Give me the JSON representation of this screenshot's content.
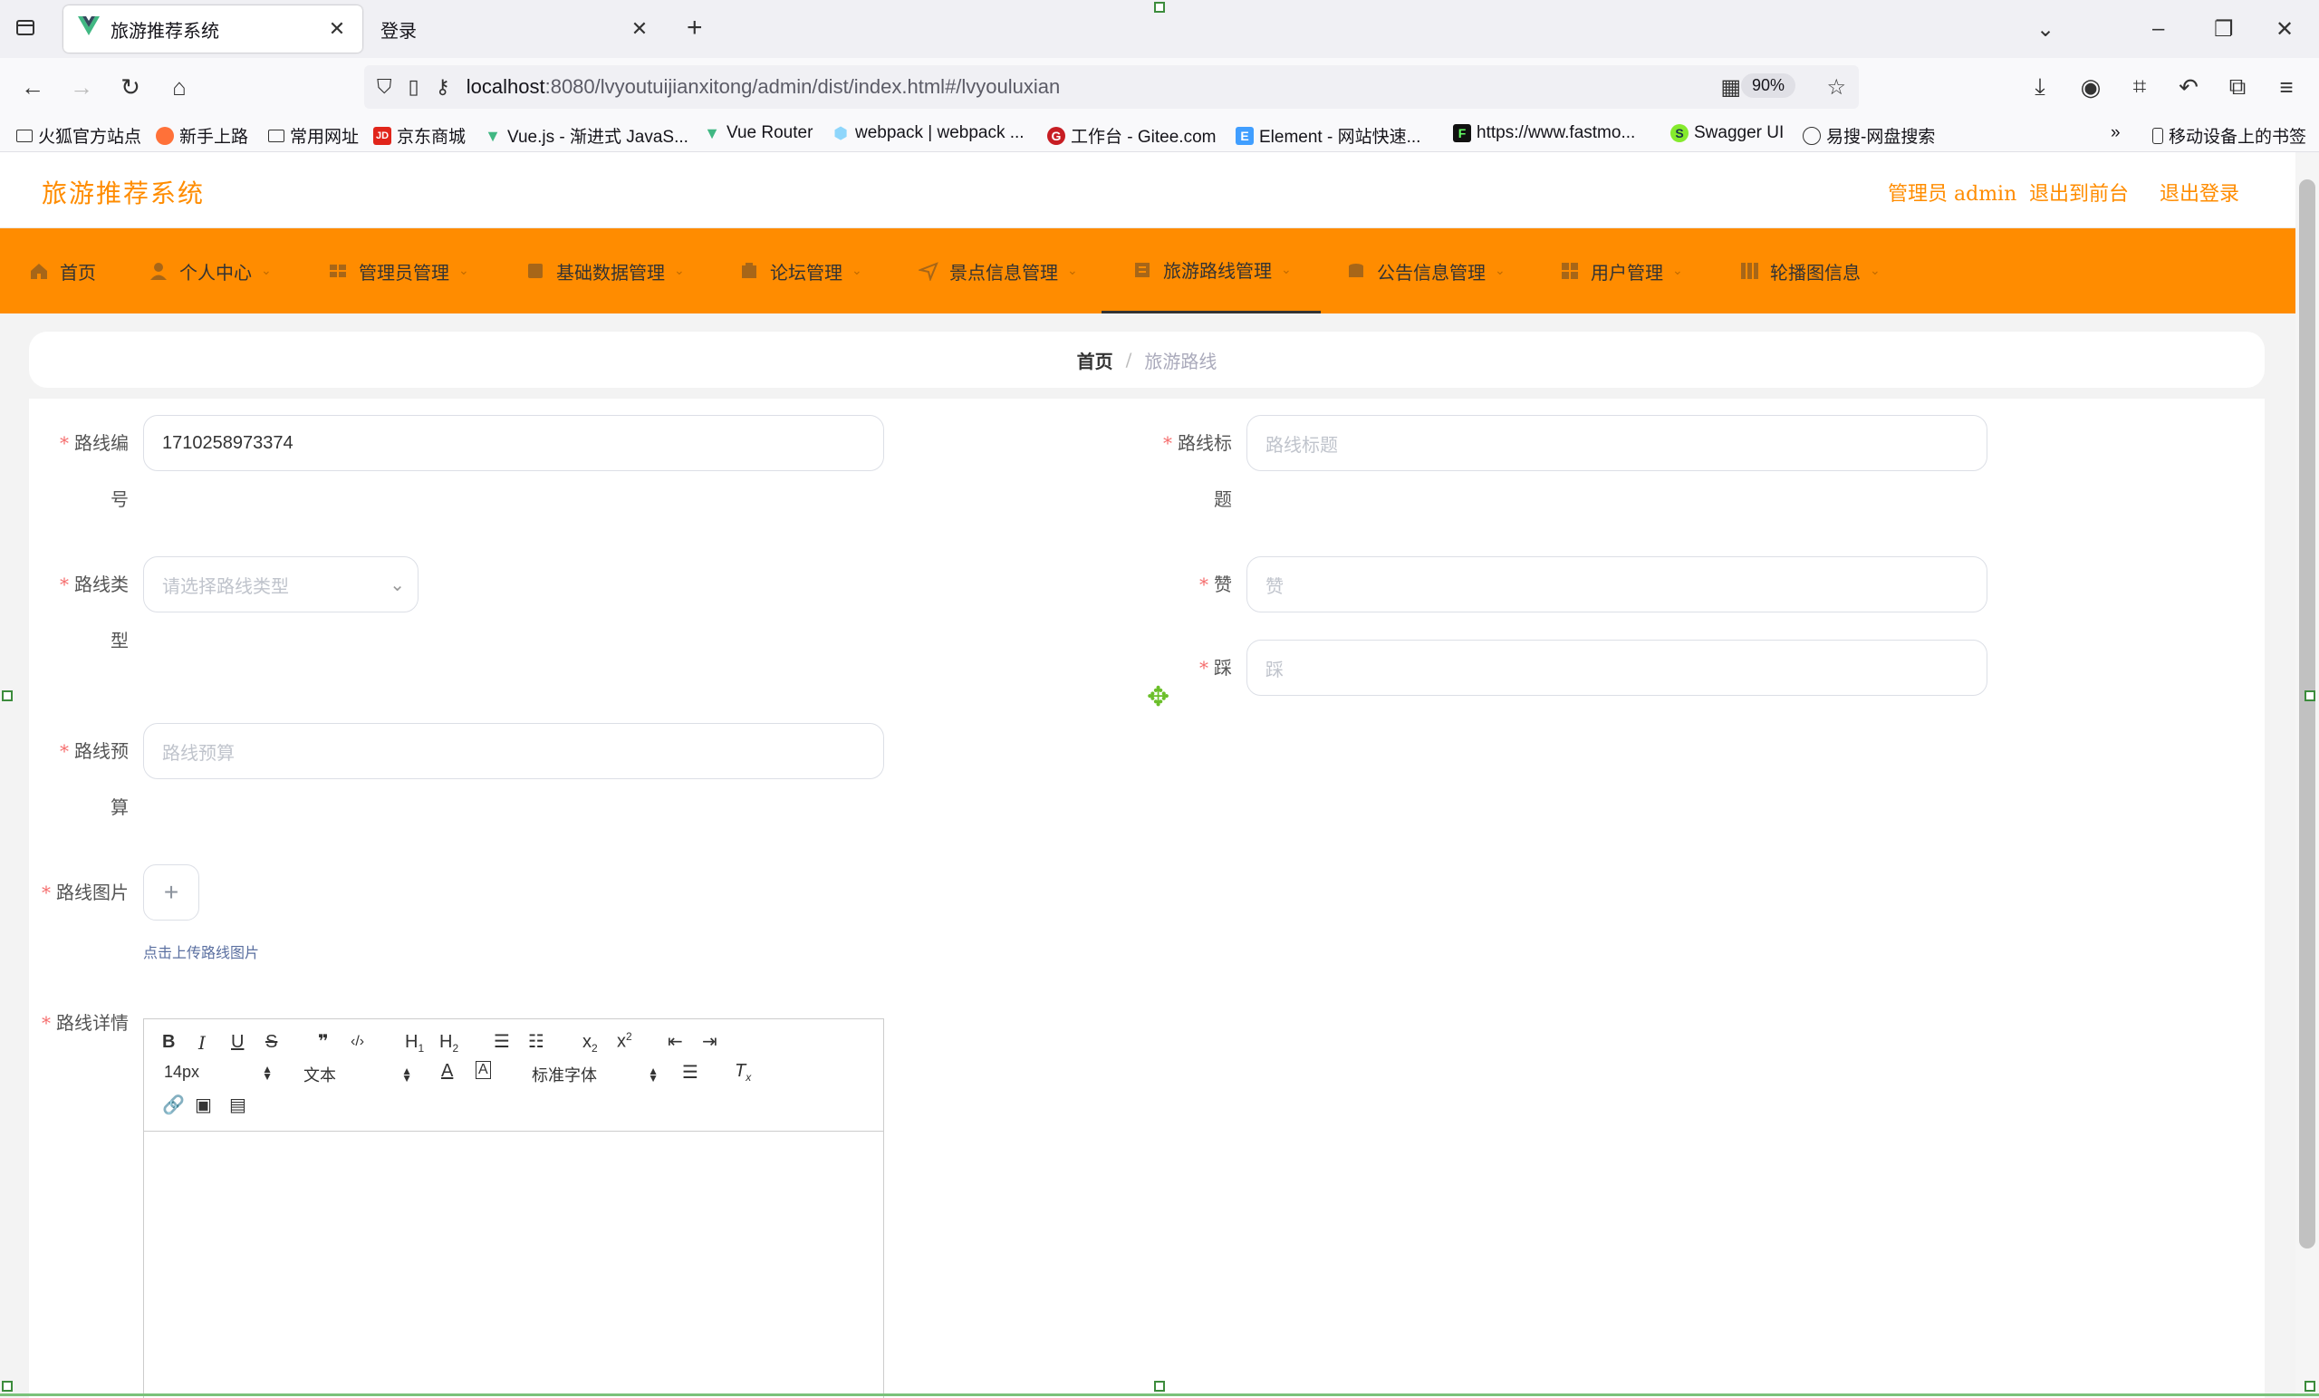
{
  "browser": {
    "tabs": [
      {
        "title": "旅游推荐系统",
        "active": true
      },
      {
        "title": "登录",
        "active": false
      }
    ],
    "url_host": "localhost",
    "url_rest": ":8080/lvyoutuijianxitong/admin/dist/index.html#/lvyouluxian",
    "zoom": "90%",
    "bookmarks": [
      {
        "label": "火狐官方站点",
        "icon": "folder-icon"
      },
      {
        "label": "新手上路",
        "icon": "firefox-icon"
      },
      {
        "label": "常用网址",
        "icon": "folder-icon"
      },
      {
        "label": "京东商城",
        "icon": "jd-icon"
      },
      {
        "label": "Vue.js - 渐进式 JavaS...",
        "icon": "vue-icon"
      },
      {
        "label": "Vue Router",
        "icon": "vue-icon"
      },
      {
        "label": "webpack | webpack ...",
        "icon": "webpack-icon"
      },
      {
        "label": "工作台 - Gitee.com",
        "icon": "gitee-icon"
      },
      {
        "label": "Element - 网站快速...",
        "icon": "element-icon"
      },
      {
        "label": "https://www.fastmo...",
        "icon": "fastmock-icon"
      },
      {
        "label": "Swagger UI",
        "icon": "swagger-icon"
      },
      {
        "label": "易搜-网盘搜索",
        "icon": "globe-icon"
      }
    ],
    "mobile_bookmarks": "移动设备上的书签"
  },
  "app": {
    "title": "旅游推荐系统",
    "header_links": [
      "管理员 admin",
      "退出到前台",
      "退出登录"
    ],
    "menu": [
      {
        "label": "首页",
        "icon": "home-icon",
        "has_sub": false
      },
      {
        "label": "个人中心",
        "icon": "user-icon",
        "has_sub": true
      },
      {
        "label": "管理员管理",
        "icon": "admin-icon",
        "has_sub": true
      },
      {
        "label": "基础数据管理",
        "icon": "database-icon",
        "has_sub": true
      },
      {
        "label": "论坛管理",
        "icon": "forum-icon",
        "has_sub": true
      },
      {
        "label": "景点信息管理",
        "icon": "location-icon",
        "has_sub": true
      },
      {
        "label": "旅游路线管理",
        "icon": "route-icon",
        "has_sub": true,
        "active": true
      },
      {
        "label": "公告信息管理",
        "icon": "notice-icon",
        "has_sub": true
      },
      {
        "label": "用户管理",
        "icon": "users-icon",
        "has_sub": true
      },
      {
        "label": "轮播图信息",
        "icon": "carousel-icon",
        "has_sub": true
      }
    ],
    "breadcrumb": {
      "home": "首页",
      "separator": "/",
      "current": "旅游路线"
    }
  },
  "form": {
    "route_no": {
      "label_1": "路线编",
      "label_2": "号",
      "value": "1710258973374"
    },
    "route_title": {
      "label_1": "路线标",
      "label_2": "题",
      "placeholder": "路线标题"
    },
    "route_type": {
      "label_1": "路线类",
      "label_2": "型",
      "placeholder": "请选择路线类型"
    },
    "like": {
      "label": "赞",
      "placeholder": "赞"
    },
    "dislike": {
      "label": "踩",
      "placeholder": "踩"
    },
    "budget": {
      "label_1": "路线预",
      "label_2": "算",
      "placeholder": "路线预算"
    },
    "image": {
      "label": "路线图片",
      "tip": "点击上传路线图片"
    },
    "detail": {
      "label": "路线详情",
      "toolbar": {
        "font_size": "14px",
        "heading": "文本",
        "font_family": "标准字体",
        "buttons_row1": [
          "B",
          "I",
          "U",
          "S",
          "❞",
          "</>",
          "H1",
          "H2"
        ],
        "buttons_row2": [
          "A",
          "A"
        ]
      }
    }
  }
}
